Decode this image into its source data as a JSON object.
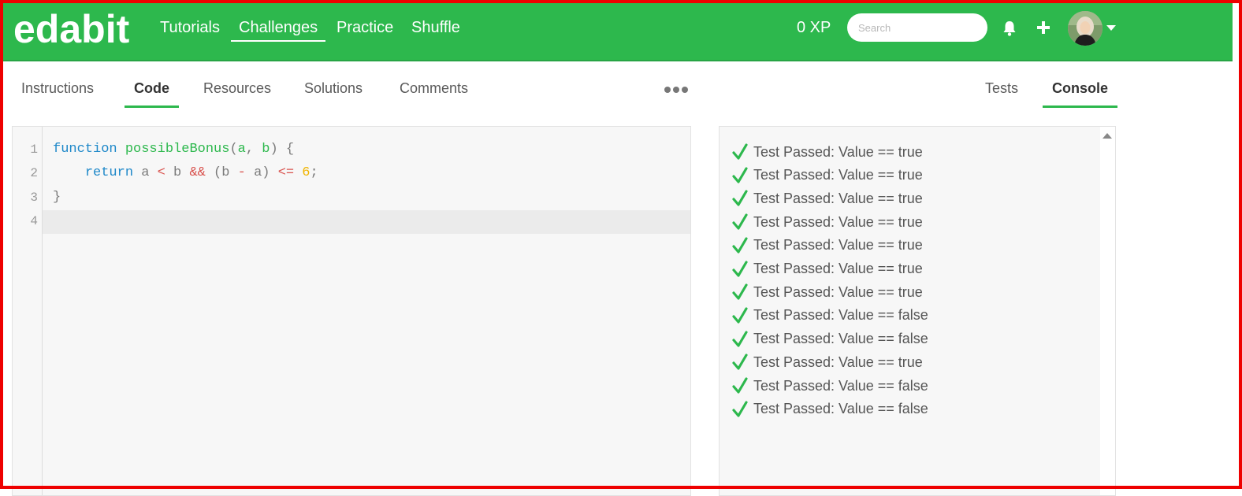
{
  "navbar": {
    "logo": "edabit",
    "links": [
      "Tutorials",
      "Challenges",
      "Practice",
      "Shuffle"
    ],
    "active_link": "Challenges",
    "xp": "0 XP",
    "search_placeholder": "Search"
  },
  "tabs_left": [
    "Instructions",
    "Code",
    "Resources",
    "Solutions",
    "Comments"
  ],
  "tabs_right": [
    "Tests",
    "Console"
  ],
  "active_tabs": [
    "Code",
    "Console"
  ],
  "editor": {
    "line_numbers": [
      "1",
      "2",
      "3",
      "4"
    ],
    "code": {
      "l1_kw": "function",
      "l1_fn": "possibleBonus",
      "l1_p1": "(",
      "l1_a": "a",
      "l1_comma": ", ",
      "l1_b": "b",
      "l1_p2": ") {",
      "l2_kw": "return",
      "l2_a": " a ",
      "l2_lt": "<",
      "l2_b": " b ",
      "l2_and": "&&",
      "l2_paren": " (b ",
      "l2_minus": "-",
      "l2_a2": " a) ",
      "l2_le": "<=",
      "l2_sp": " ",
      "l2_num": "6",
      "l2_semi": ";",
      "l3": "}"
    }
  },
  "console": {
    "results": [
      "Test Passed: Value == true",
      "Test Passed: Value == true",
      "Test Passed: Value == true",
      "Test Passed: Value == true",
      "Test Passed: Value == true",
      "Test Passed: Value == true",
      "Test Passed: Value == true",
      "Test Passed: Value == false",
      "Test Passed: Value == false",
      "Test Passed: Value == true",
      "Test Passed: Value == false",
      "Test Passed: Value == false"
    ]
  },
  "colors": {
    "brand": "#2db84d",
    "keyword": "#1e88c9",
    "operator": "#d9534f",
    "number": "#f0b400",
    "border_highlight": "#ee0000"
  },
  "icons": [
    "bell-icon",
    "plus-icon",
    "chevron-down-icon",
    "more-dots-icon",
    "check-icon",
    "scroll-up-icon"
  ]
}
